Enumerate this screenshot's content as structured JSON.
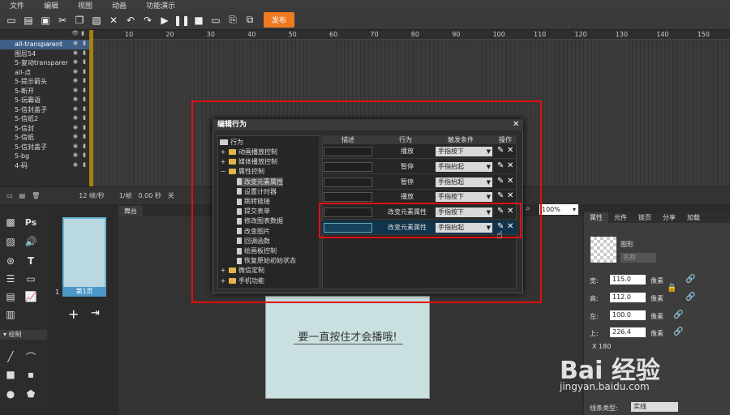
{
  "menu": [
    "文件",
    "编辑",
    "视图",
    "动画",
    "功能演示"
  ],
  "toolbar": {
    "publish_label": "发布"
  },
  "layers": {
    "items": [
      "all-transparent",
      "图层54",
      "5-复动transparer",
      "all-点",
      "5-提示箭头",
      "5-断开",
      "5-玩霸语",
      "5-信封盖子",
      "5-信纸2",
      "5-信封",
      "5-信纸",
      "5-信封盖子",
      "5-bg",
      "4-码"
    ],
    "selected_index": 0
  },
  "timeline": {
    "ticks": [
      "10",
      "20",
      "30",
      "40",
      "50",
      "60",
      "70",
      "80",
      "90",
      "100",
      "110",
      "120",
      "130",
      "140",
      "150"
    ]
  },
  "status": {
    "fps": "12 帧/秒",
    "frame": "1/帧",
    "time": "0.00 秒",
    "extra": "关"
  },
  "pages": {
    "thumb_label": "第1页",
    "page_num": "1"
  },
  "stage": {
    "tab_label": "舞台",
    "canvas_text": "要一直按住才会播哦!"
  },
  "zoom": "100%",
  "right_panel": {
    "tabs": [
      "属性",
      "元件",
      "链页",
      "分享",
      "加载"
    ],
    "image_label": "图形",
    "name_placeholder": "名称",
    "width_label": "宽:",
    "width_value": "115.0",
    "height_label": "高:",
    "height_value": "112.0",
    "left_label": "左:",
    "left_value": "100.0",
    "top_label": "上:",
    "top_value": "226.4",
    "unit": "像素",
    "extra_row": "X 180",
    "line_type_label": "线条类型:",
    "line_type_value": "实线"
  },
  "tools": {
    "draw_label": "绘制"
  },
  "dialog": {
    "title": "编辑行为",
    "tree": {
      "root": "行为",
      "nodes": [
        {
          "label": "动画播放控制",
          "type": "folder",
          "indent": 1,
          "exp": "+"
        },
        {
          "label": "媒体播放控制",
          "type": "folder",
          "indent": 1,
          "exp": "+"
        },
        {
          "label": "属性控制",
          "type": "folder",
          "indent": 1,
          "exp": "−"
        },
        {
          "label": "改变元素属性",
          "type": "doc",
          "indent": 2,
          "selected": true
        },
        {
          "label": "设置计时器",
          "type": "doc",
          "indent": 2
        },
        {
          "label": "跳转链接",
          "type": "doc",
          "indent": 2
        },
        {
          "label": "提交表单",
          "type": "doc",
          "indent": 2
        },
        {
          "label": "修改图表数据",
          "type": "doc",
          "indent": 2
        },
        {
          "label": "改变图片",
          "type": "doc",
          "indent": 2
        },
        {
          "label": "回调函数",
          "type": "doc",
          "indent": 2
        },
        {
          "label": "绘画板控制",
          "type": "doc",
          "indent": 2
        },
        {
          "label": "恢复原始初始状态",
          "type": "doc",
          "indent": 2
        },
        {
          "label": "微信定制",
          "type": "folder",
          "indent": 1,
          "exp": "+"
        },
        {
          "label": "手机功能",
          "type": "folder",
          "indent": 1,
          "exp": "+"
        }
      ]
    },
    "table": {
      "headers": [
        "描述",
        "行为",
        "触发条件",
        "操作"
      ],
      "rows": [
        {
          "action": "播放",
          "trigger": "手指按下"
        },
        {
          "action": "暂停",
          "trigger": "手指抬起"
        },
        {
          "action": "暂停",
          "trigger": "手指抬起"
        },
        {
          "action": "播放",
          "trigger": "手指按下"
        },
        {
          "action": "改变元素属性",
          "trigger": "手指按下"
        },
        {
          "action": "改变元素属性",
          "trigger": "手指抬起",
          "selected": true
        }
      ]
    }
  },
  "watermark": {
    "main": "Bai 经验",
    "sub": "jingyan.baidu.com"
  }
}
